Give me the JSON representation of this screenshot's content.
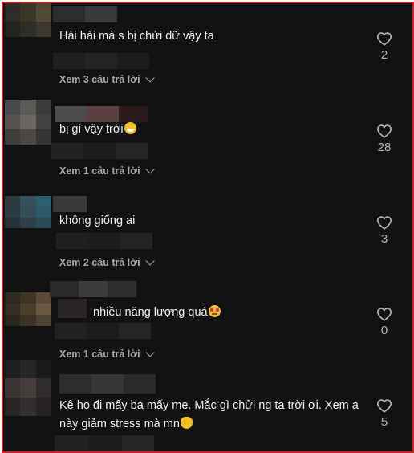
{
  "comments": [
    {
      "text": "Hài hài mà s bị chửi dữ vậy ta",
      "emoji": "",
      "replies_label": "Xem 3 câu trả lời",
      "likes": "2"
    },
    {
      "text": "bị gì vậy trời",
      "emoji": "grinning-sweat-emoji",
      "replies_label": "Xem 1 câu trả lời",
      "likes": "28"
    },
    {
      "text": "không giống ai",
      "emoji": "",
      "replies_label": "Xem 2 câu trả lời",
      "likes": "3"
    },
    {
      "text": "nhiều năng lượng quá",
      "emoji": "smiling-hearts-emoji",
      "replies_label": "Xem 1 câu trả lời",
      "likes": "0"
    },
    {
      "text": "Kệ họ đi mấy ba mấy mẹ. Mắc gì chửi ng ta trời ơi. Xem a này giảm stress mà mn",
      "emoji": "waving-hand-emoji",
      "replies_label": "",
      "likes": "5"
    }
  ],
  "icons": {
    "like": "heart-outline-icon",
    "expand": "chevron-down-icon"
  },
  "colors": {
    "background": "#121212",
    "border": "#d21f1f",
    "text": "#f1f1f1",
    "muted": "#a8a8a8"
  }
}
